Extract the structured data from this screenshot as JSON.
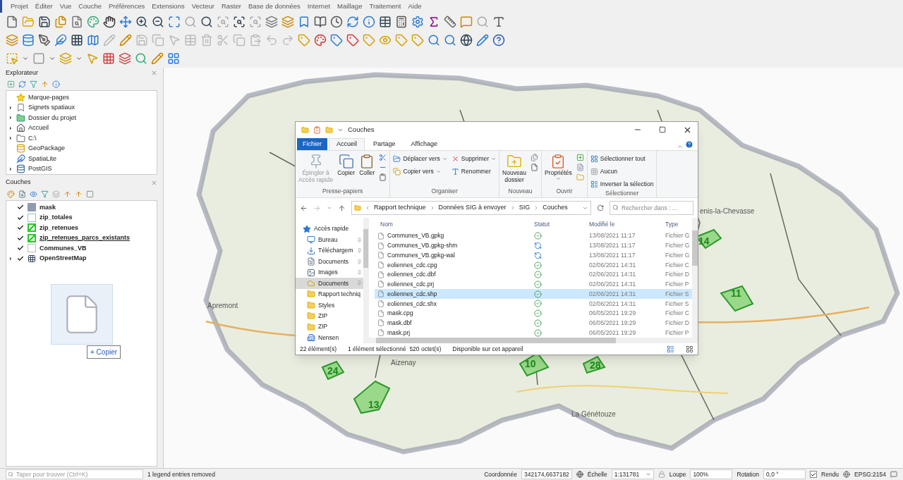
{
  "menu": [
    "Projet",
    "Éditer",
    "Vue",
    "Couche",
    "Préférences",
    "Extensions",
    "Vecteur",
    "Raster",
    "Base de données",
    "Internet",
    "Maillage",
    "Traitement",
    "Aide"
  ],
  "explorer_panel": {
    "title": "Explorateur",
    "items": [
      {
        "label": "Marque-pages",
        "kind": "bookmarks",
        "expandable": false
      },
      {
        "label": "Signets spatiaux",
        "kind": "spatial",
        "expandable": true
      },
      {
        "label": "Dossier du projet",
        "kind": "project",
        "expandable": true
      },
      {
        "label": "Accueil",
        "kind": "home",
        "expandable": true
      },
      {
        "label": "C:\\",
        "kind": "drive",
        "expandable": true
      },
      {
        "label": "GeoPackage",
        "kind": "geopackage",
        "expandable": false
      },
      {
        "label": "SpatiaLite",
        "kind": "spatialite",
        "expandable": false
      },
      {
        "label": "PostGIS",
        "kind": "postgis",
        "expandable": true
      }
    ]
  },
  "layers_panel": {
    "title": "Couches",
    "layers": [
      {
        "name": "mask",
        "checked": true,
        "kind": "fill",
        "current": false,
        "expandable": false
      },
      {
        "name": "zip_totales",
        "checked": true,
        "kind": "outline",
        "current": false,
        "expandable": false
      },
      {
        "name": "zip_retenues",
        "checked": true,
        "kind": "hatch",
        "current": false,
        "expandable": false
      },
      {
        "name": "zip_retenues_parcs_existants",
        "checked": true,
        "kind": "hatch",
        "current": true,
        "expandable": false
      },
      {
        "name": "Communes_VB",
        "checked": true,
        "kind": "plain",
        "current": false,
        "expandable": false
      },
      {
        "name": "OpenStreetMap",
        "checked": true,
        "kind": "raster",
        "current": false,
        "expandable": true
      }
    ]
  },
  "drag": {
    "tooltip": "+ Copier"
  },
  "map": {
    "labels": [
      {
        "kind": "place",
        "text": "Apremont"
      },
      {
        "kind": "place",
        "text": "Aizenay"
      },
      {
        "kind": "place",
        "text": "La Génétouze"
      },
      {
        "kind": "place",
        "text": "enis-la-Chevasse"
      },
      {
        "kind": "zone",
        "text": "24"
      },
      {
        "kind": "zone",
        "text": "13"
      },
      {
        "kind": "zone",
        "text": "10"
      },
      {
        "kind": "zone",
        "text": "28"
      },
      {
        "kind": "zone",
        "text": "14"
      },
      {
        "kind": "zone",
        "text": "11"
      }
    ]
  },
  "file_explorer": {
    "title": "Couches",
    "tabs": [
      {
        "label": "Fichier",
        "kind": "file",
        "selected": false
      },
      {
        "label": "Accueil",
        "kind": "tab",
        "selected": true
      },
      {
        "label": "Partage",
        "kind": "tab",
        "selected": false
      },
      {
        "label": "Affichage",
        "kind": "tab",
        "selected": false
      }
    ],
    "groups": [
      {
        "label": "Presse-papiers",
        "buttons": [
          {
            "lines": [
              "Épingler à",
              "Accès rapide"
            ],
            "kind": "large",
            "disabled": true,
            "dropdown": false
          },
          {
            "lines": [
              "Copier"
            ],
            "kind": "large",
            "disabled": false,
            "dropdown": false
          },
          {
            "lines": [
              "Coller"
            ],
            "kind": "large",
            "disabled": false,
            "dropdown": false
          }
        ]
      },
      {
        "label": "Organiser",
        "buttons": [
          {
            "lines": [
              "Déplacer vers"
            ],
            "kind": "small",
            "disabled": false,
            "dropdown": true
          },
          {
            "lines": [
              "Copier vers"
            ],
            "kind": "small",
            "disabled": false,
            "dropdown": true
          },
          {
            "lines": [
              "Supprimer"
            ],
            "kind": "small",
            "disabled": false,
            "dropdown": true
          },
          {
            "lines": [
              "Renommer"
            ],
            "kind": "small",
            "disabled": false,
            "dropdown": false
          }
        ]
      },
      {
        "label": "Nouveau",
        "buttons": [
          {
            "lines": [
              "Nouveau",
              "dossier"
            ],
            "kind": "large",
            "disabled": false,
            "dropdown": false
          }
        ]
      },
      {
        "label": "Ouvrir",
        "buttons": [
          {
            "lines": [
              "Propriétés"
            ],
            "kind": "large",
            "disabled": false,
            "dropdown": true
          }
        ]
      },
      {
        "label": "Sélectionner",
        "buttons": [
          {
            "lines": [
              "Sélectionner tout"
            ],
            "kind": "small",
            "disabled": false,
            "dropdown": false
          },
          {
            "lines": [
              "Aucun"
            ],
            "kind": "small",
            "disabled": false,
            "dropdown": false
          },
          {
            "lines": [
              "Inverser la sélection"
            ],
            "kind": "small",
            "disabled": false,
            "dropdown": false
          }
        ]
      }
    ],
    "path": [
      "Rapport technique",
      "Données SIG à envoyer",
      "SIG",
      "Couches"
    ],
    "search": {
      "placeholder": "Rechercher dans : ..."
    },
    "nav": [
      {
        "label": "Accès rapide",
        "kind": "star",
        "pinned": false,
        "selected": false
      },
      {
        "label": "Bureau",
        "kind": "desktop",
        "pinned": true,
        "selected": false
      },
      {
        "label": "Téléchargem",
        "kind": "download",
        "pinned": true,
        "selected": false
      },
      {
        "label": "Documents",
        "kind": "docs",
        "pinned": true,
        "selected": false
      },
      {
        "label": "Images",
        "kind": "images",
        "pinned": true,
        "selected": false
      },
      {
        "label": "Documents",
        "kind": "cloud",
        "pinned": true,
        "selected": true
      },
      {
        "label": "Rapport techniq",
        "kind": "folder",
        "pinned": false,
        "selected": false
      },
      {
        "label": "Styles",
        "kind": "folder",
        "pinned": false,
        "selected": false
      },
      {
        "label": "ZIP",
        "kind": "folder",
        "pinned": false,
        "selected": false
      },
      {
        "label": "ZIP",
        "kind": "folder",
        "pinned": false,
        "selected": false
      },
      {
        "label": "Nensen",
        "kind": "building",
        "pinned": false,
        "selected": false
      }
    ],
    "columns": [
      "Nom",
      "Statut",
      "Modifié le",
      "Type"
    ],
    "files": [
      {
        "name": "Communes_VB.gpkg",
        "kind": "synced",
        "modified": "13/08/2021 11:17",
        "type": "Fichier G",
        "selected": false
      },
      {
        "name": "Communes_VB.gpkg-shm",
        "kind": "syncing",
        "modified": "13/08/2021 11:17",
        "type": "Fichier G",
        "selected": false
      },
      {
        "name": "Communes_VB.gpkg-wal",
        "kind": "syncing",
        "modified": "13/08/2021 11:17",
        "type": "Fichier G",
        "selected": false
      },
      {
        "name": "eoliennes_cdc.cpg",
        "kind": "synced",
        "modified": "02/06/2021 14:31",
        "type": "Fichier C",
        "selected": false
      },
      {
        "name": "eoliennes_cdc.dbf",
        "kind": "synced",
        "modified": "02/06/2021 14:31",
        "type": "Fichier D",
        "selected": false
      },
      {
        "name": "eoliennes_cdc.prj",
        "kind": "synced",
        "modified": "02/06/2021 14:31",
        "type": "Fichier P",
        "selected": false
      },
      {
        "name": "eoliennes_cdc.shp",
        "kind": "synced",
        "modified": "02/06/2021 14:31",
        "type": "Fichier S",
        "selected": true
      },
      {
        "name": "eoliennes_cdc.shx",
        "kind": "synced",
        "modified": "02/06/2021 14:31",
        "type": "Fichier S",
        "selected": false
      },
      {
        "name": "mask.cpg",
        "kind": "synced",
        "modified": "06/05/2021 19:29",
        "type": "Fichier C",
        "selected": false
      },
      {
        "name": "mask.dbf",
        "kind": "synced",
        "modified": "06/05/2021 19:29",
        "type": "Fichier D",
        "selected": false
      },
      {
        "name": "mask.prj",
        "kind": "synced",
        "modified": "06/05/2021 19:29",
        "type": "Fichier P",
        "selected": false
      }
    ],
    "status": [
      "22 élément(s)",
      "1 élément sélectionné  520 octet(s)",
      "Disponible sur cet appareil"
    ]
  },
  "status_bar": {
    "search_placeholder": "Taper pour trouver (Ctrl+K)",
    "message": "1 legend entries removed",
    "coordinate_label": "Coordonnée",
    "coordinate": "342174,6637182",
    "scale_label": "Échelle",
    "scale": "1:131781",
    "magnifier_label": "Loupe",
    "magnifier": "100%",
    "rotation_label": "Rotation",
    "rotation": "0,0 °",
    "render_checked": true,
    "render_label": "Rendu",
    "crs": "EPSG:2154"
  }
}
